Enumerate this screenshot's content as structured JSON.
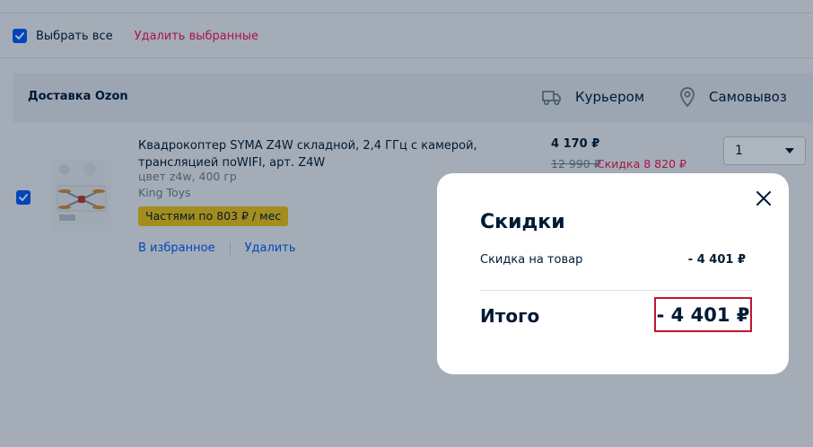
{
  "toolbar": {
    "select_all_label": "Выбрать все",
    "delete_selected_label": "Удалить выбранные"
  },
  "delivery": {
    "title": "Доставка Ozon",
    "options": [
      {
        "label": "Курьером",
        "icon": "truck-icon"
      },
      {
        "label": "Самовывоз",
        "icon": "location-pin-icon"
      }
    ]
  },
  "product": {
    "name": "Квадрокоптер SYMA Z4W складной, 2,4 ГГц с камерой, трансляцией поWIFI, арт. Z4W",
    "color": "цвет z4w, 400 гр",
    "seller": "King Toys",
    "installment": "Частями по 803 ₽ / мес",
    "actions": [
      "В избранное",
      "Удалить"
    ],
    "price_current": "4 170 ₽",
    "price_old": "12 990 ₽",
    "discount": "Скидка 8 820 ₽",
    "quantity": "1"
  },
  "modal": {
    "title": "Скидки",
    "lines": [
      {
        "label": "Скидка на товар",
        "value": "- 4 401 ₽"
      }
    ],
    "total_label": "Итого",
    "total_value": "- 4 401 ₽"
  },
  "colors": {
    "accent": "#005bff",
    "danger": "#f91155",
    "badge": "#f0c412",
    "highlight_border": "#c0162e"
  }
}
